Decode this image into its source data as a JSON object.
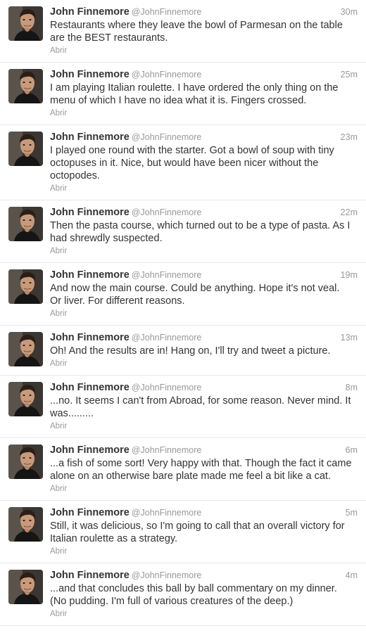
{
  "tweets": [
    {
      "name": "John Finnemore",
      "handle": "@JohnFinnemore",
      "time": "30m",
      "text": "Restaurants where they leave the bowl of Parmesan on the table are the BEST restaurants.",
      "open": "Abrir"
    },
    {
      "name": "John Finnemore",
      "handle": "@JohnFinnemore",
      "time": "25m",
      "text": "I am playing Italian roulette. I have ordered the only thing on the menu of which I have no idea what it is. Fingers crossed.",
      "open": "Abrir"
    },
    {
      "name": "John Finnemore",
      "handle": "@JohnFinnemore",
      "time": "23m",
      "text": "I played one round with the starter. Got a bowl of soup with tiny octopuses in it. Nice, but would have been nicer without the octopodes.",
      "open": "Abrir"
    },
    {
      "name": "John Finnemore",
      "handle": "@JohnFinnemore",
      "time": "22m",
      "text": "Then the pasta course, which turned out to be a type of pasta. As I had shrewdly suspected.",
      "open": "Abrir"
    },
    {
      "name": "John Finnemore",
      "handle": "@JohnFinnemore",
      "time": "19m",
      "text": "And now the main course. Could be anything. Hope it's not veal. Or liver. For different reasons.",
      "open": "Abrir"
    },
    {
      "name": "John Finnemore",
      "handle": "@JohnFinnemore",
      "time": "13m",
      "text": "Oh! And the results are in! Hang on, I'll try and tweet a picture.",
      "open": "Abrir"
    },
    {
      "name": "John Finnemore",
      "handle": "@JohnFinnemore",
      "time": "8m",
      "text": "...no. It seems I can't from Abroad, for some reason. Never mind. It was.........",
      "open": "Abrir"
    },
    {
      "name": "John Finnemore",
      "handle": "@JohnFinnemore",
      "time": "6m",
      "text": "...a fish of some sort! Very happy with that. Though the fact it came alone on an otherwise bare plate made me feel a bit like a cat.",
      "open": "Abrir"
    },
    {
      "name": "John Finnemore",
      "handle": "@JohnFinnemore",
      "time": "5m",
      "text": "Still, it was delicious, so I'm going to call that an overall victory for Italian roulette as a strategy.",
      "open": "Abrir"
    },
    {
      "name": "John Finnemore",
      "handle": "@JohnFinnemore",
      "time": "4m",
      "text": "...and that concludes this ball by ball commentary on my dinner. (No pudding. I'm full of various creatures of the deep.)",
      "open": "Abrir"
    }
  ]
}
